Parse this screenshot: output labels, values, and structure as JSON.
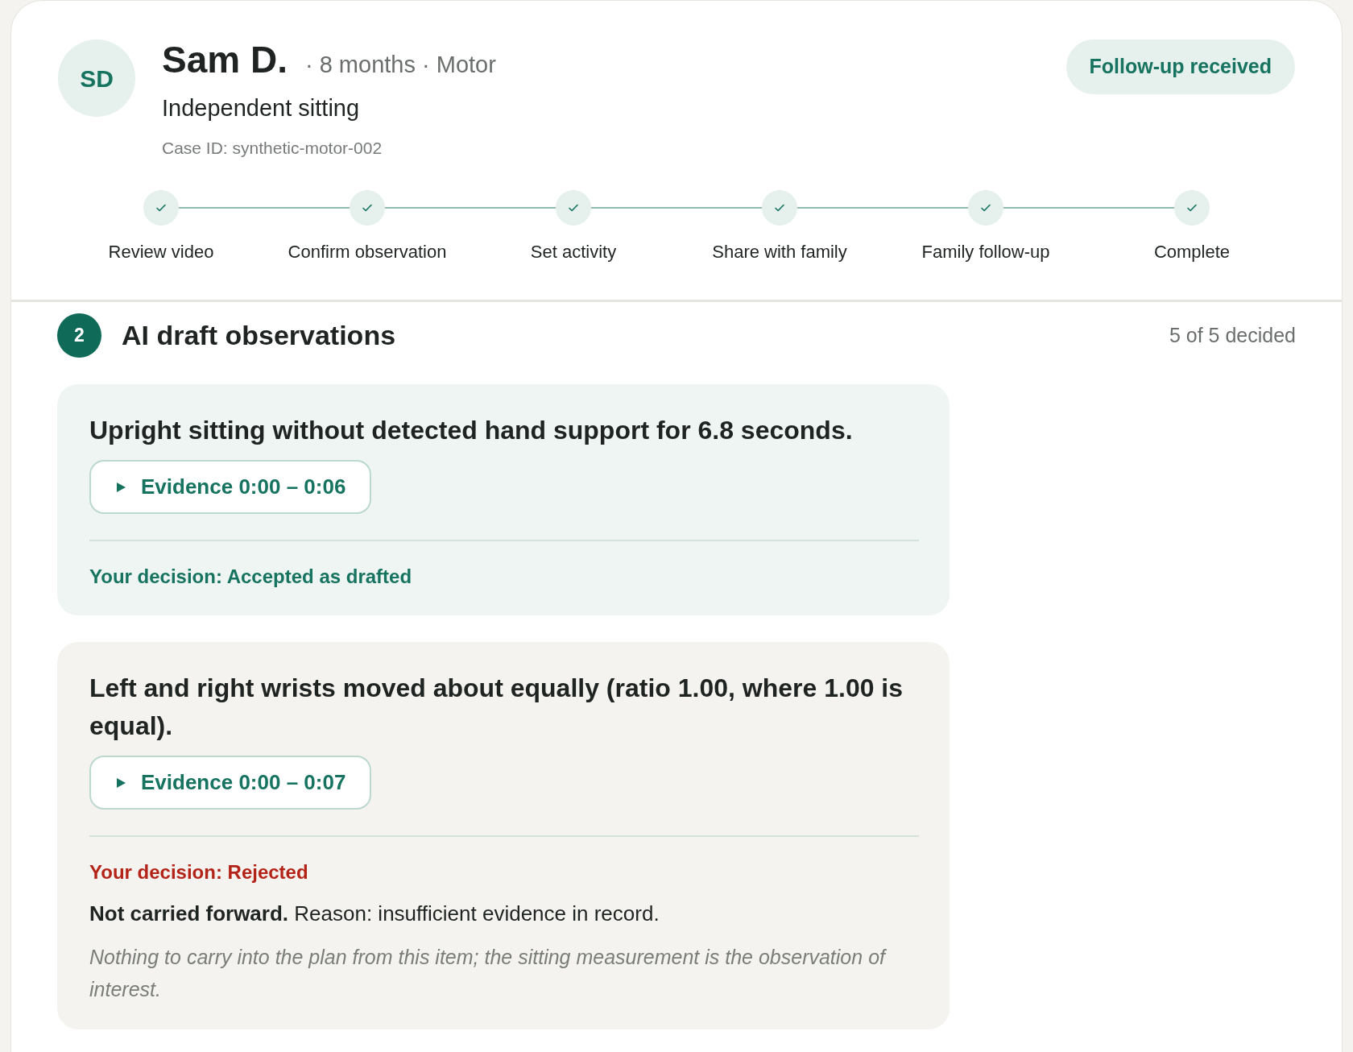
{
  "patient": {
    "initials": "SD",
    "name": "Sam D.",
    "meta": "· 8 months · Motor",
    "milestone": "Independent sitting",
    "case_id": "Case ID: synthetic-motor-002"
  },
  "status_badge": "Follow-up received",
  "steps": [
    {
      "label": "Review video",
      "done": true
    },
    {
      "label": "Confirm observation",
      "done": true
    },
    {
      "label": "Set activity",
      "done": true
    },
    {
      "label": "Share with family",
      "done": true
    },
    {
      "label": "Family follow-up",
      "done": true
    },
    {
      "label": "Complete",
      "done": true
    }
  ],
  "section": {
    "number": "2",
    "title": "AI draft observations",
    "progress": "5 of 5 decided"
  },
  "observations": [
    {
      "text": "Upright sitting without detected hand support for 6.8 seconds.",
      "evidence": "Evidence 0:00 – 0:06",
      "decision": {
        "kind": "accepted",
        "label": "Your decision: Accepted as drafted"
      }
    },
    {
      "text": "Left and right wrists moved about equally (ratio 1.00, where 1.00 is equal).",
      "evidence": "Evidence 0:00 – 0:07",
      "decision": {
        "kind": "rejected",
        "label": "Your decision: Rejected",
        "reason": "**Not carried forward.** Reason: insufficient evidence in record.",
        "note": "Nothing to carry into the plan from this item; the sitting measurement is the observation of interest."
      }
    }
  ]
}
